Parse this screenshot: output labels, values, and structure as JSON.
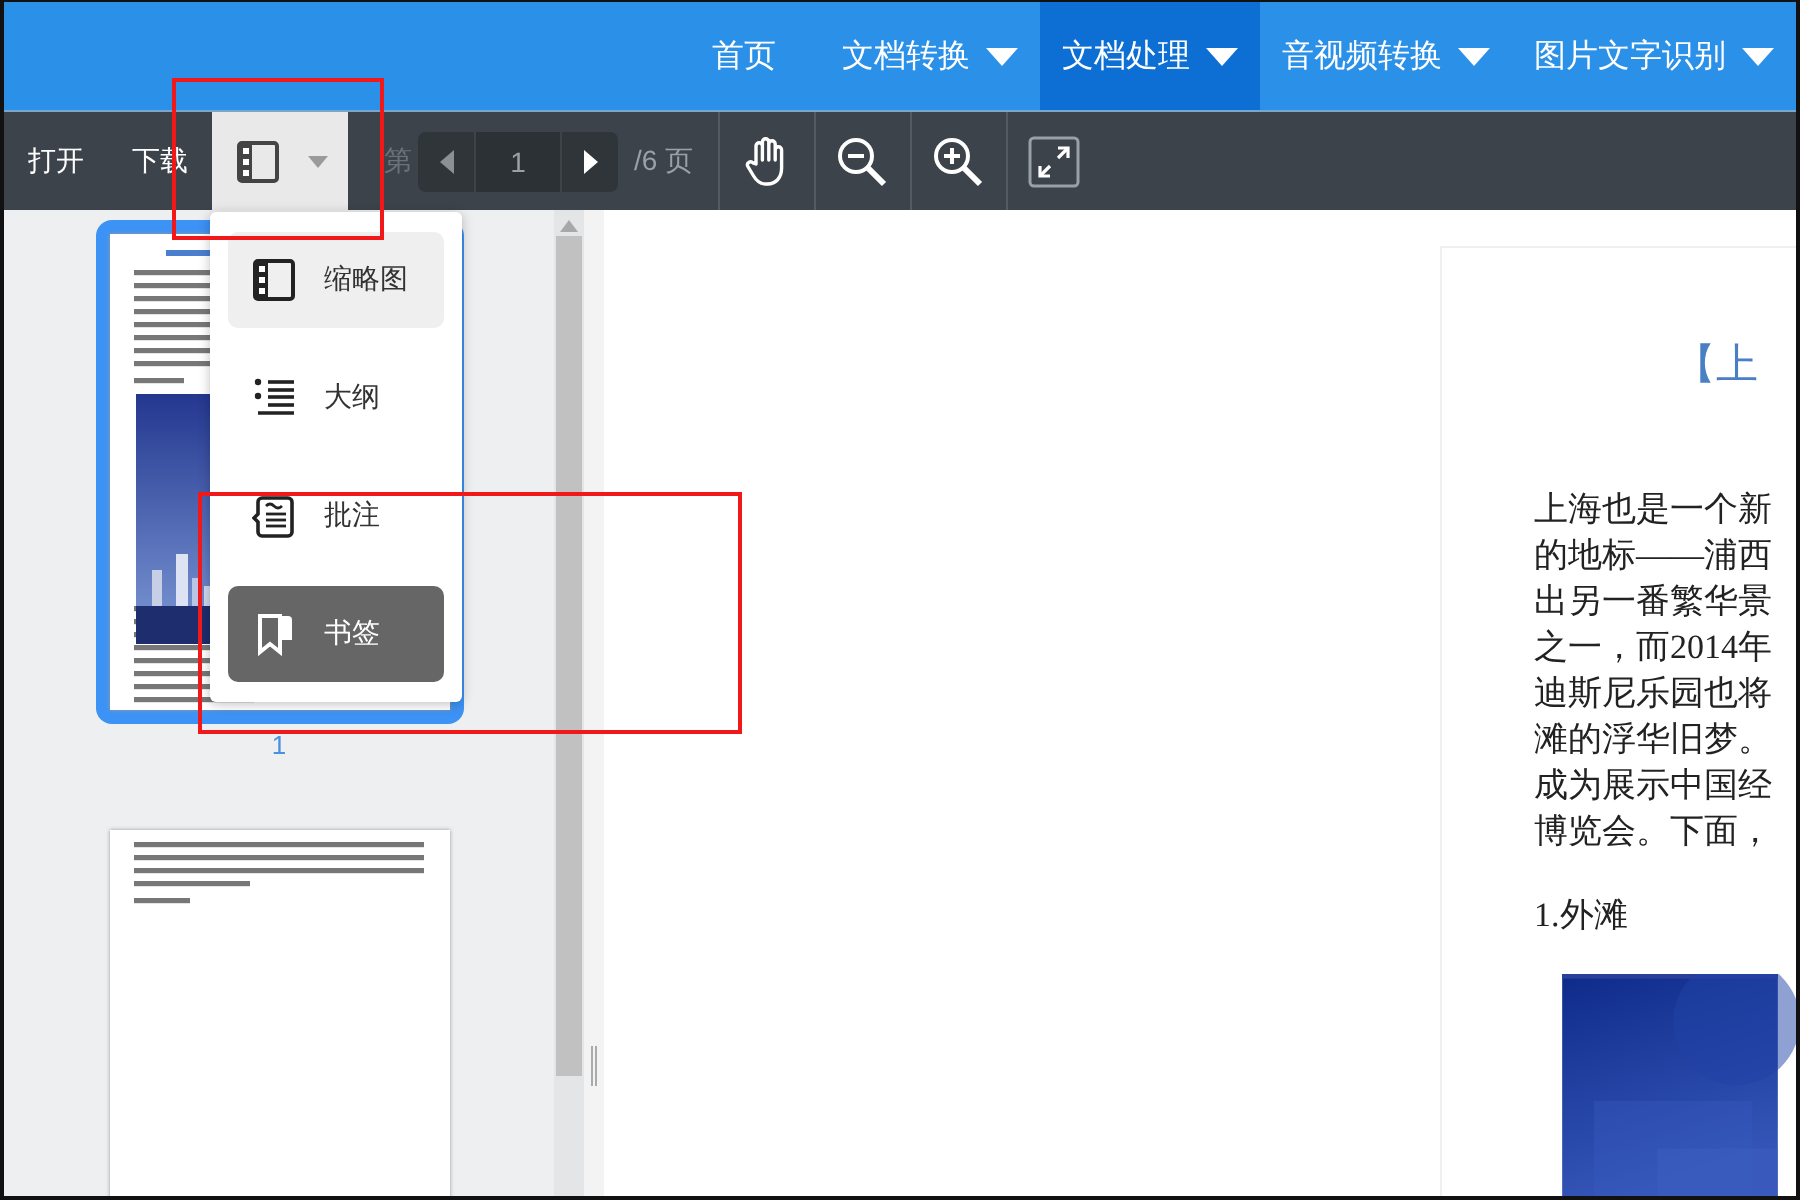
{
  "nav": {
    "items": [
      {
        "label": "首页",
        "has_menu": false,
        "selected": false
      },
      {
        "label": "文档转换",
        "has_menu": true,
        "selected": false
      },
      {
        "label": "文档处理",
        "has_menu": true,
        "selected": true
      },
      {
        "label": "音视频转换",
        "has_menu": true,
        "selected": false
      },
      {
        "label": "图片文字识别",
        "has_menu": true,
        "selected": false
      }
    ]
  },
  "toolbar": {
    "open": "打开",
    "download": "下载",
    "view_toggle": {
      "open": true
    },
    "page_prefix": "第",
    "page_input": "1",
    "page_total": "/6 页"
  },
  "view_menu": {
    "items": [
      {
        "label": "缩略图",
        "kind": "thumbnails",
        "selected": true,
        "highlighted": false
      },
      {
        "label": "大纲",
        "kind": "outline",
        "selected": false,
        "highlighted": false
      },
      {
        "label": "批注",
        "kind": "comment",
        "selected": false,
        "highlighted": false
      },
      {
        "label": "书签",
        "kind": "bookmark",
        "selected": false,
        "highlighted": true
      }
    ]
  },
  "sidebar": {
    "thumbnails": [
      {
        "page_number": "1",
        "selected": true,
        "kind": "photo_page"
      },
      {
        "selected": false,
        "kind": "text_page"
      }
    ]
  },
  "document": {
    "title": "【上",
    "lines": [
      "上海也是一个新",
      "的地标——浦西",
      "出另一番繁华景",
      "之一，而2014年",
      "迪斯尼乐园也将",
      "滩的浮华旧梦。",
      "成为展示中国经",
      "博览会。下面，"
    ],
    "heading": "1.外滩"
  },
  "highlight_frames": [
    {
      "kind": "frame"
    },
    {
      "kind": "frame"
    }
  ]
}
